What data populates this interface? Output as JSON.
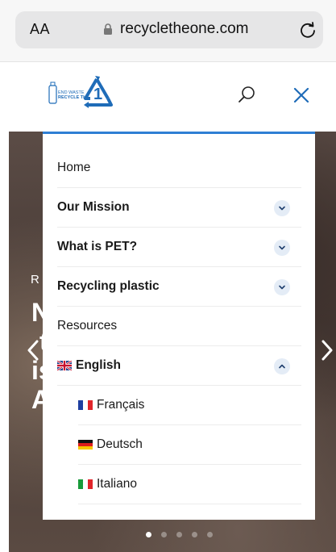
{
  "browser": {
    "text_size_label": "AA",
    "url": "recycletheone.com"
  },
  "header": {
    "logo_text_1": "END WASTE",
    "logo_text_2": "RECYCLE THE",
    "logo_number": "1"
  },
  "menu": {
    "items": [
      {
        "label": "Home"
      },
      {
        "label": "Our Mission"
      },
      {
        "label": "What is PET?"
      },
      {
        "label": "Recycling plastic"
      },
      {
        "label": "Resources"
      },
      {
        "label": "English"
      },
      {
        "label": "Français"
      },
      {
        "label": "Deutsch"
      },
      {
        "label": "Italiano"
      }
    ]
  },
  "hero": {
    "small_text": "R",
    "big_lines": [
      "N",
      "t",
      "is",
      "A"
    ],
    "slide_count": 5,
    "active_slide": 1
  },
  "colors": {
    "accent": "#2f7fd4",
    "logo_blue": "#1f6cb8",
    "chevron_bg": "#e4ecf6"
  },
  "icons": {
    "lock": "lock-icon",
    "reload": "reload-icon",
    "search": "search-icon",
    "close": "close-icon",
    "chevron_down": "chevron-down-icon",
    "chevron_up": "chevron-up-icon"
  }
}
